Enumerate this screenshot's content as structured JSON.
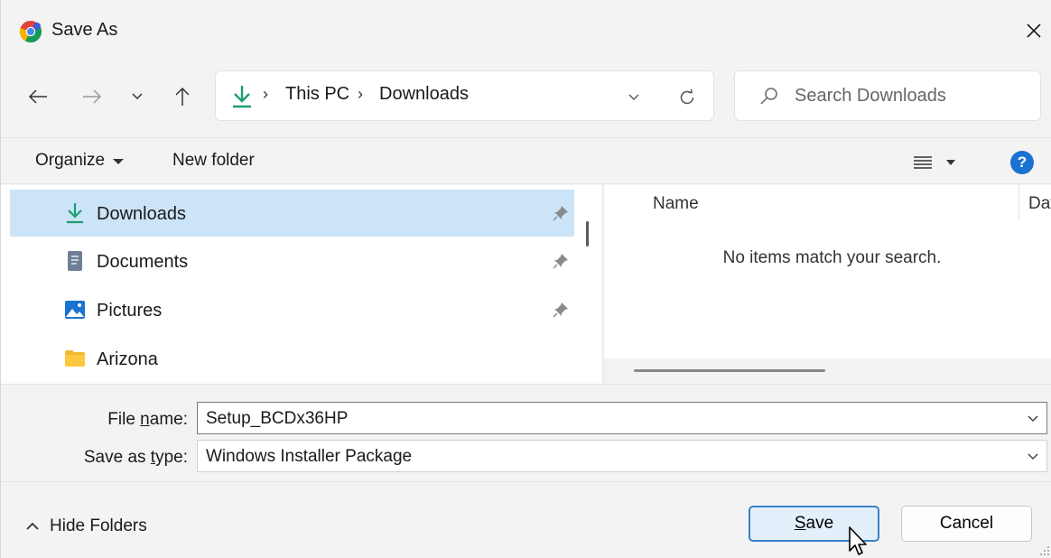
{
  "window": {
    "title": "Save As"
  },
  "address": {
    "crumbs": [
      "This PC",
      "Downloads"
    ]
  },
  "search": {
    "placeholder": "Search Downloads"
  },
  "commandbar": {
    "organize_label": "Organize",
    "new_folder_label": "New folder",
    "help_label": "?"
  },
  "nav_pane": {
    "items": [
      {
        "label": "Downloads",
        "icon": "download-icon",
        "pinned": true,
        "selected": true
      },
      {
        "label": "Documents",
        "icon": "document-icon",
        "pinned": true,
        "selected": false
      },
      {
        "label": "Pictures",
        "icon": "pictures-icon",
        "pinned": true,
        "selected": false
      },
      {
        "label": "Arizona",
        "icon": "folder-icon",
        "pinned": false,
        "selected": false
      }
    ]
  },
  "file_list": {
    "columns": [
      "Name",
      "Dat"
    ],
    "empty_message": "No items match your search."
  },
  "form": {
    "file_name": {
      "label_pre": "File ",
      "label_key": "n",
      "label_post": "ame:",
      "value": "Setup_BCDx36HP"
    },
    "save_type": {
      "label_pre": "Save as ",
      "label_key": "t",
      "label_post": "ype:",
      "value": "Windows Installer Package"
    }
  },
  "footer": {
    "hide_folders_label": "Hide Folders",
    "save": {
      "key": "S",
      "rest": "ave"
    },
    "cancel_label": "Cancel"
  },
  "colors": {
    "accent": "#1a73d0",
    "selection": "#cce4f7",
    "download_green": "#1e9e6e"
  }
}
